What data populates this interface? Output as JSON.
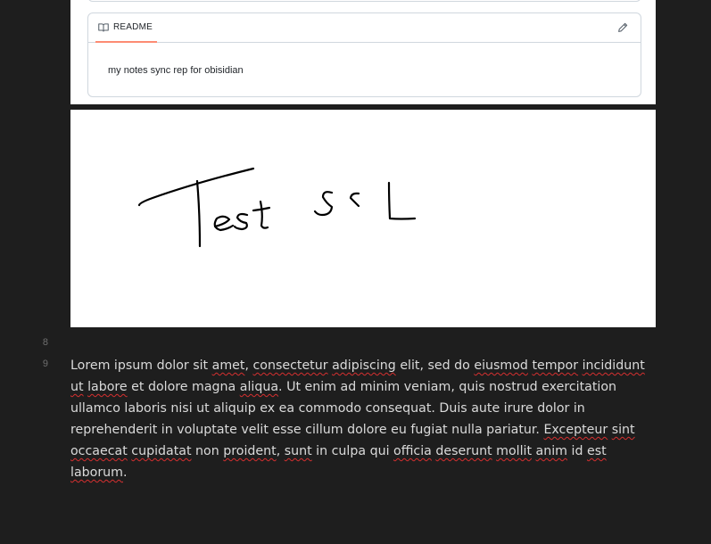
{
  "readme": {
    "tab_label": "README",
    "body_text": "my notes sync rep for obisidian",
    "tab_icon": "book-icon",
    "edit_icon": "pencil-icon",
    "tab_underline_color": "#fd8c73"
  },
  "sketch": {
    "handwritten_text": "Test SSL"
  },
  "editor": {
    "line_numbers": [
      "8",
      "9"
    ],
    "paragraph": [
      {
        "t": "Lorem ipsum dolor sit "
      },
      {
        "t": "amet",
        "err": true
      },
      {
        "t": ", "
      },
      {
        "t": "consectetur",
        "err": true
      },
      {
        "t": " "
      },
      {
        "t": "adipiscing",
        "err": true
      },
      {
        "t": " elit, sed do "
      },
      {
        "t": "eiusmod",
        "err": true
      },
      {
        "t": " "
      },
      {
        "t": "tempor",
        "err": true
      },
      {
        "t": " "
      },
      {
        "t": "incididunt",
        "err": true
      },
      {
        "t": " "
      },
      {
        "t": "ut",
        "err": true
      },
      {
        "t": " "
      },
      {
        "t": "labore",
        "err": true
      },
      {
        "t": " et dolore magna "
      },
      {
        "t": "aliqua",
        "err": true
      },
      {
        "t": ". Ut enim ad minim veniam, quis nostrud exercitation ullamco laboris nisi ut aliquip ex ea commodo consequat. Duis aute irure dolor in reprehenderit in voluptate velit esse cillum dolore eu fugiat nulla pariatur. "
      },
      {
        "t": "Excepteur",
        "err": true
      },
      {
        "t": " "
      },
      {
        "t": "sint",
        "err": true
      },
      {
        "t": " "
      },
      {
        "t": "occaecat",
        "err": true
      },
      {
        "t": " "
      },
      {
        "t": "cupidatat",
        "err": true
      },
      {
        "t": " non "
      },
      {
        "t": "proident",
        "err": true
      },
      {
        "t": ", "
      },
      {
        "t": "sunt",
        "err": true
      },
      {
        "t": " in culpa qui "
      },
      {
        "t": "officia",
        "err": true
      },
      {
        "t": " "
      },
      {
        "t": "deserunt",
        "err": true
      },
      {
        "t": " "
      },
      {
        "t": "mollit",
        "err": true
      },
      {
        "t": " "
      },
      {
        "t": "anim",
        "err": true
      },
      {
        "t": " id "
      },
      {
        "t": "est",
        "err": true
      },
      {
        "t": " "
      },
      {
        "t": "laborum",
        "err": true
      },
      {
        "t": "."
      }
    ]
  }
}
